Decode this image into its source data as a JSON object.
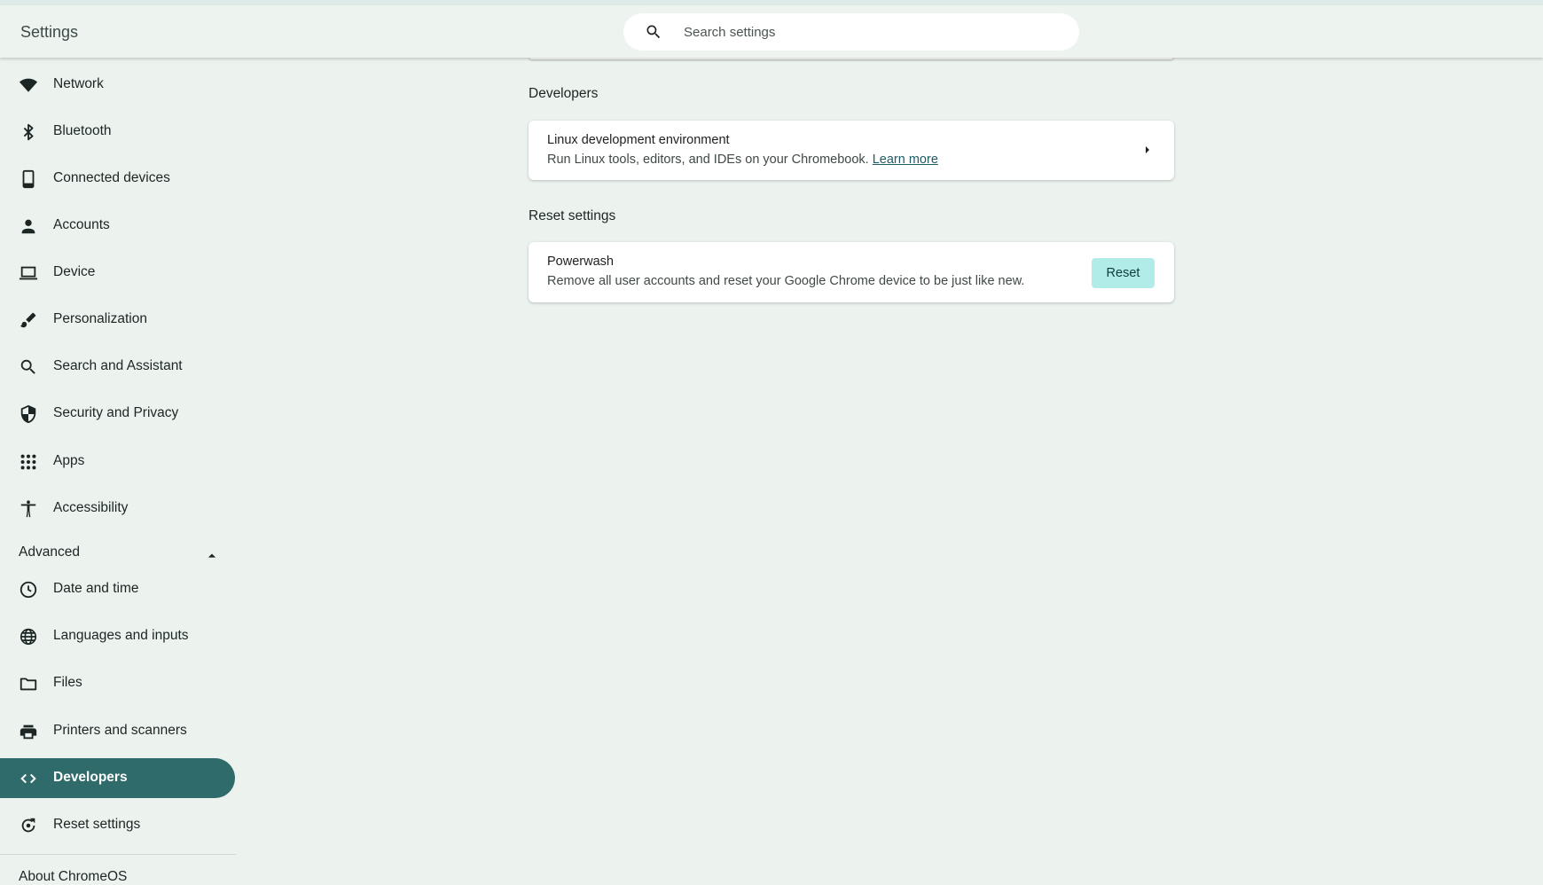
{
  "header": {
    "title": "Settings",
    "search": {
      "placeholder": "Search settings",
      "icon": "search-icon"
    }
  },
  "sidebar": {
    "items": [
      {
        "label": "Network",
        "icon": "wifi-icon"
      },
      {
        "label": "Bluetooth",
        "icon": "bluetooth-icon"
      },
      {
        "label": "Connected devices",
        "icon": "phone-icon"
      },
      {
        "label": "Accounts",
        "icon": "person-icon"
      },
      {
        "label": "Device",
        "icon": "laptop-icon"
      },
      {
        "label": "Personalization",
        "icon": "brush-icon"
      },
      {
        "label": "Search and Assistant",
        "icon": "search-icon"
      },
      {
        "label": "Security and Privacy",
        "icon": "shield-icon"
      },
      {
        "label": "Apps",
        "icon": "grid-icon"
      },
      {
        "label": "Accessibility",
        "icon": "accessibility-icon"
      }
    ],
    "advanced": {
      "label": "Advanced",
      "expanded": true,
      "items": [
        {
          "label": "Date and time",
          "icon": "clock-icon"
        },
        {
          "label": "Languages and inputs",
          "icon": "globe-icon"
        },
        {
          "label": "Files",
          "icon": "folder-icon"
        },
        {
          "label": "Printers and scanners",
          "icon": "printer-icon"
        },
        {
          "label": "Developers",
          "icon": "code-icon",
          "active": true
        },
        {
          "label": "Reset settings",
          "icon": "reset-icon"
        }
      ]
    },
    "about_label": "About ChromeOS"
  },
  "main": {
    "developers": {
      "section_title": "Developers",
      "linux": {
        "title": "Linux development environment",
        "description": "Run Linux tools, editors, and IDEs on your Chromebook.",
        "link": "Learn more"
      }
    },
    "reset": {
      "section_title": "Reset settings",
      "powerwash": {
        "title": "Powerwash",
        "description": "Remove all user accounts and reset your Google Chrome device to be just like new.",
        "button": "Reset"
      }
    }
  },
  "colors": {
    "background": "#ecf3ef",
    "active_nav": "#2f6b6a",
    "reset_button": "#b2ece9",
    "link": "#1e5c63"
  }
}
